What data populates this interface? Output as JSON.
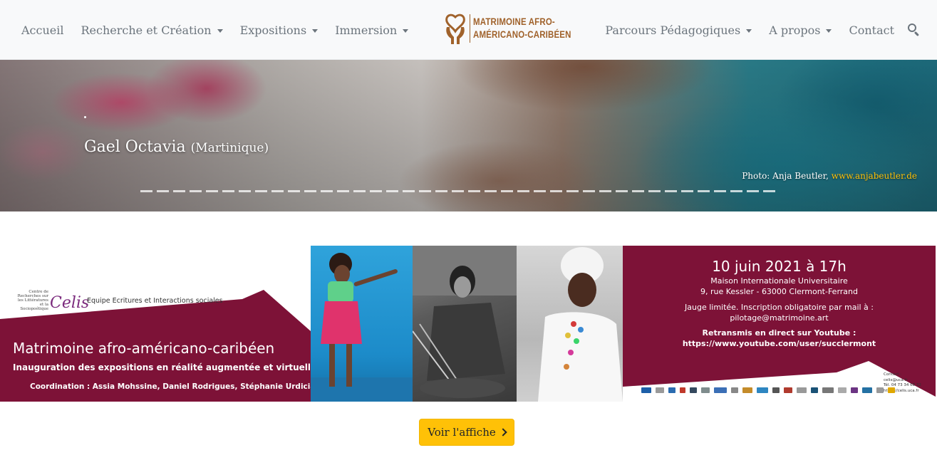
{
  "nav": {
    "left": [
      {
        "label": "Accueil",
        "dropdown": false
      },
      {
        "label": "Recherche et Création",
        "dropdown": true
      },
      {
        "label": "Expositions",
        "dropdown": true
      },
      {
        "label": "Immersion",
        "dropdown": true
      }
    ],
    "right": [
      {
        "label": "Parcours Pédagogiques",
        "dropdown": true
      },
      {
        "label": "A propos",
        "dropdown": true
      },
      {
        "label": "Contact",
        "dropdown": false
      }
    ],
    "logo_line1": "MATRIMOINE AFRO-",
    "logo_line2": "AMÉRICANO-CARIBÉEN",
    "search_icon": "search-icon"
  },
  "hero": {
    "dot": ".",
    "name": "Gael Octavia",
    "origin": "(Martinique)",
    "credit_prefix": "Photo: Anja Beutler,",
    "credit_link": "www.anjabeutler.de"
  },
  "banner": {
    "celis_small": "Centre de Recherches sur les Littératures et la Sociopoétique",
    "celis_word": "Celis",
    "celis_label": "Equipe Ecritures et Interactions sociales",
    "title": "Matrimoine afro-américano-caribéen",
    "subtitle": "Inauguration des expositions en réalité augmentée et virtuelle",
    "coordination": "Coordination : Assia Mohssine, Daniel Rodrigues, Stéphanie Urdician",
    "date": "10 juin 2021 à 17h",
    "venue": "Maison Internationale Universitaire",
    "address": "9, rue Kessler - 63000 Clermont-Ferrand",
    "jauge": "Jauge limitée. Inscription obligatoire par mail à :",
    "email": "pilotage@matrimoine.art",
    "stream_label": "Retransmis en direct sur Youtube :",
    "stream_url": "https://www.youtube.com/user/succlermont",
    "contact_lines": [
      "Contact :",
      "celis@uca.fr",
      "Tél. 04 73 34 68 32",
      "https://celis.uca.fr"
    ]
  },
  "cta": {
    "label": "Voir l'affiche"
  },
  "colors": {
    "accent": "#ffc107",
    "brand_brown": "#a0622b",
    "maroon": "#7d1237",
    "nav_text": "#6c757d"
  }
}
